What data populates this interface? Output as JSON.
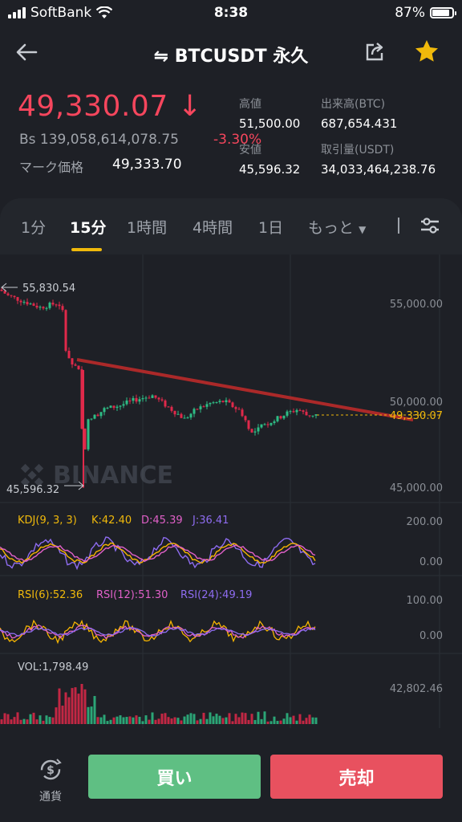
{
  "status_bar": {
    "carrier": "SoftBank",
    "time": "8:38",
    "battery": "87%",
    "battery_level": 0.87
  },
  "header": {
    "title": "BTCUSDT 永久",
    "swap_icon": "⇋"
  },
  "ticker": {
    "last_price": "49,330.07",
    "price_arrow": "↓",
    "bs_value": "Bs 139,058,614,078.75",
    "change_pct": "-3.30%",
    "mark_label": "マーク価格",
    "mark_price": "49,333.70",
    "high_label": "高値",
    "high_value": "51,500.00",
    "low_label": "安値",
    "low_value": "45,596.32",
    "vol_btc_label": "出来高(BTC)",
    "vol_btc_value": "687,654.431",
    "vol_usdt_label": "取引量(USDT)",
    "vol_usdt_value": "34,033,464,238.76"
  },
  "timeframes": [
    {
      "label": "1分"
    },
    {
      "label": "15分"
    },
    {
      "label": "1時間"
    },
    {
      "label": "4時間"
    },
    {
      "label": "1日"
    },
    {
      "label": "もっと"
    }
  ],
  "active_timeframe": "15分",
  "chart": {
    "watermark": "BINANCE",
    "max_marker": "55,830.54",
    "min_marker": "45,596.32",
    "price_axis": [
      "55,000.00",
      "50,000.00",
      "45,000.00"
    ],
    "current_price_label": "49,330.07",
    "kdj_label": "KDJ(9, 3, 3)",
    "kdj_k": "K:42.40",
    "kdj_d": "D:45.39",
    "kdj_j": "J:36.41",
    "kdj_axis": [
      "200.00",
      "0.00"
    ],
    "rsi6": "RSI(6):52.36",
    "rsi12": "RSI(12):51.30",
    "rsi24": "RSI(24):49.19",
    "rsi_axis": [
      "100.00",
      "0.00"
    ],
    "vol_label": "VOL:1,798.49",
    "vol_axis": "42,802.46",
    "colors": {
      "up": "#2ebd85",
      "down": "#e0294a",
      "trend": "#b32a2a",
      "kdj_k": "#f7b500",
      "kdj_d": "#e060c8",
      "kdj_j": "#8e6cf0",
      "accent": "#f0b90b"
    }
  },
  "footer": {
    "coin_label": "通貨",
    "buy_label": "買い",
    "sell_label": "売却"
  }
}
